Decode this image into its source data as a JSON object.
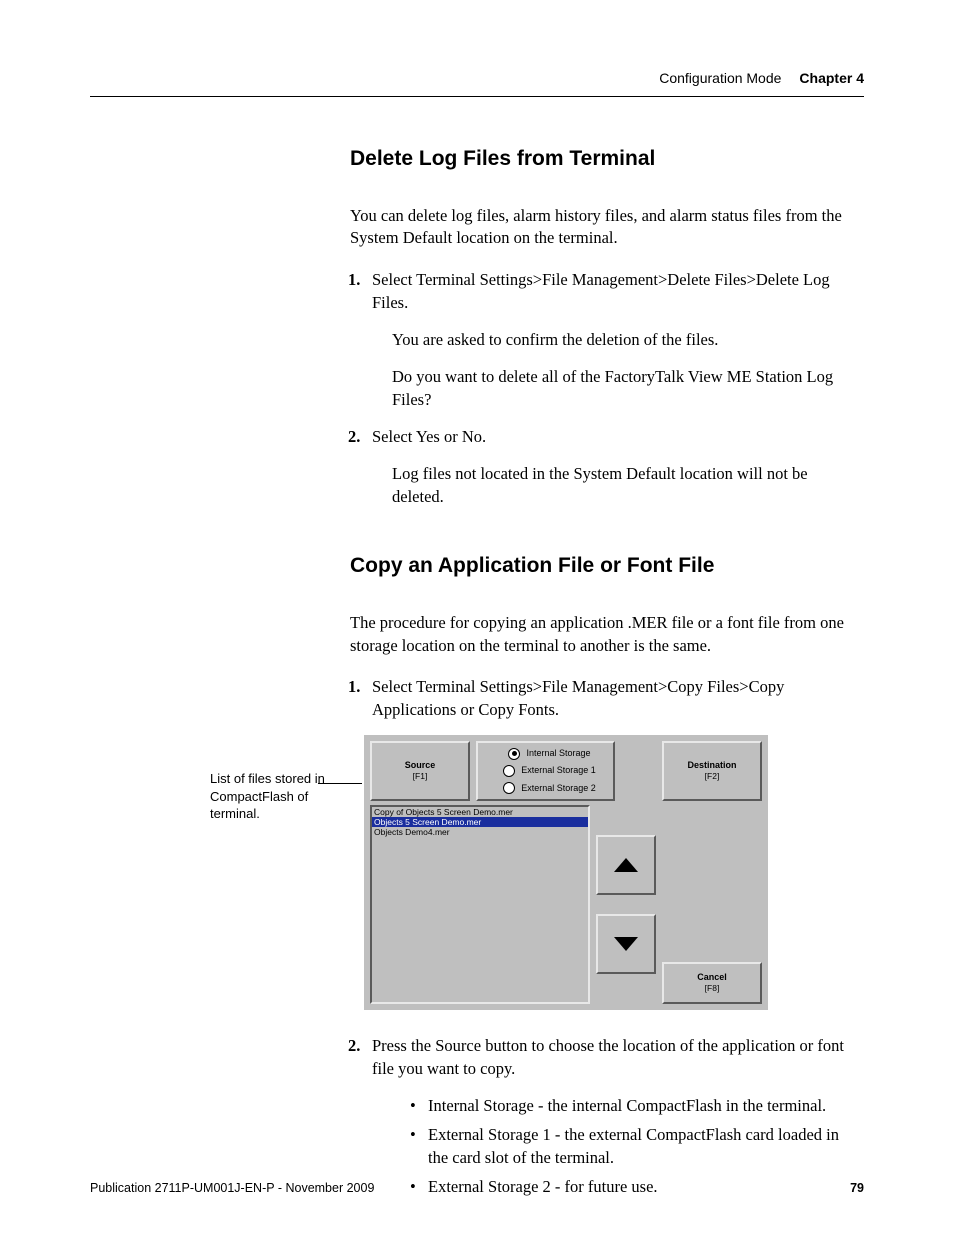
{
  "header": {
    "section": "Configuration Mode",
    "chapter": "Chapter 4"
  },
  "section1": {
    "title": "Delete Log Files from Terminal",
    "intro": "You can delete log files, alarm history files, and alarm status files from the System Default location on the terminal.",
    "step1_num": "1.",
    "step1": "Select Terminal Settings>File Management>Delete Files>Delete Log Files.",
    "step1_a": "You are asked to confirm the deletion of the files.",
    "step1_b": "Do you want to delete all of the FactoryTalk View ME Station Log Files?",
    "step2_num": "2.",
    "step2": "Select Yes or No.",
    "step2_a": "Log files not located in the System Default location will not be deleted."
  },
  "section2": {
    "title": "Copy an Application File or Font File",
    "intro": "The procedure for copying an application .MER file or a font file from one storage location on the terminal to another is the same.",
    "step1_num": "1.",
    "step1": "Select Terminal Settings>File Management>Copy Files>Copy Applications or Copy Fonts.",
    "step2_num": "2.",
    "step2": "Press the Source button to choose the location of the application or font file you want to copy.",
    "bul1": "Internal Storage - the internal CompactFlash in the terminal.",
    "bul2": "External Storage 1 - the external CompactFlash card loaded in the card slot of the terminal.",
    "bul3": "External Storage 2 - for future use."
  },
  "margin_note": "List of files stored in CompactFlash of terminal.",
  "shot": {
    "source_label": "Source",
    "source_key": "[F1]",
    "dest_label": "Destination",
    "dest_key": "[F2]",
    "radio1": "Internal Storage",
    "radio2": "External Storage 1",
    "radio3": "External Storage 2",
    "file1": "Copy of Objects 5 Screen Demo.mer",
    "file2": "Objects 5 Screen Demo.mer",
    "file3": "Objects Demo4.mer",
    "cancel_label": "Cancel",
    "cancel_key": "[F8]"
  },
  "footer": {
    "pub": "Publication 2711P-UM001J-EN-P - November 2009",
    "page": "79"
  }
}
